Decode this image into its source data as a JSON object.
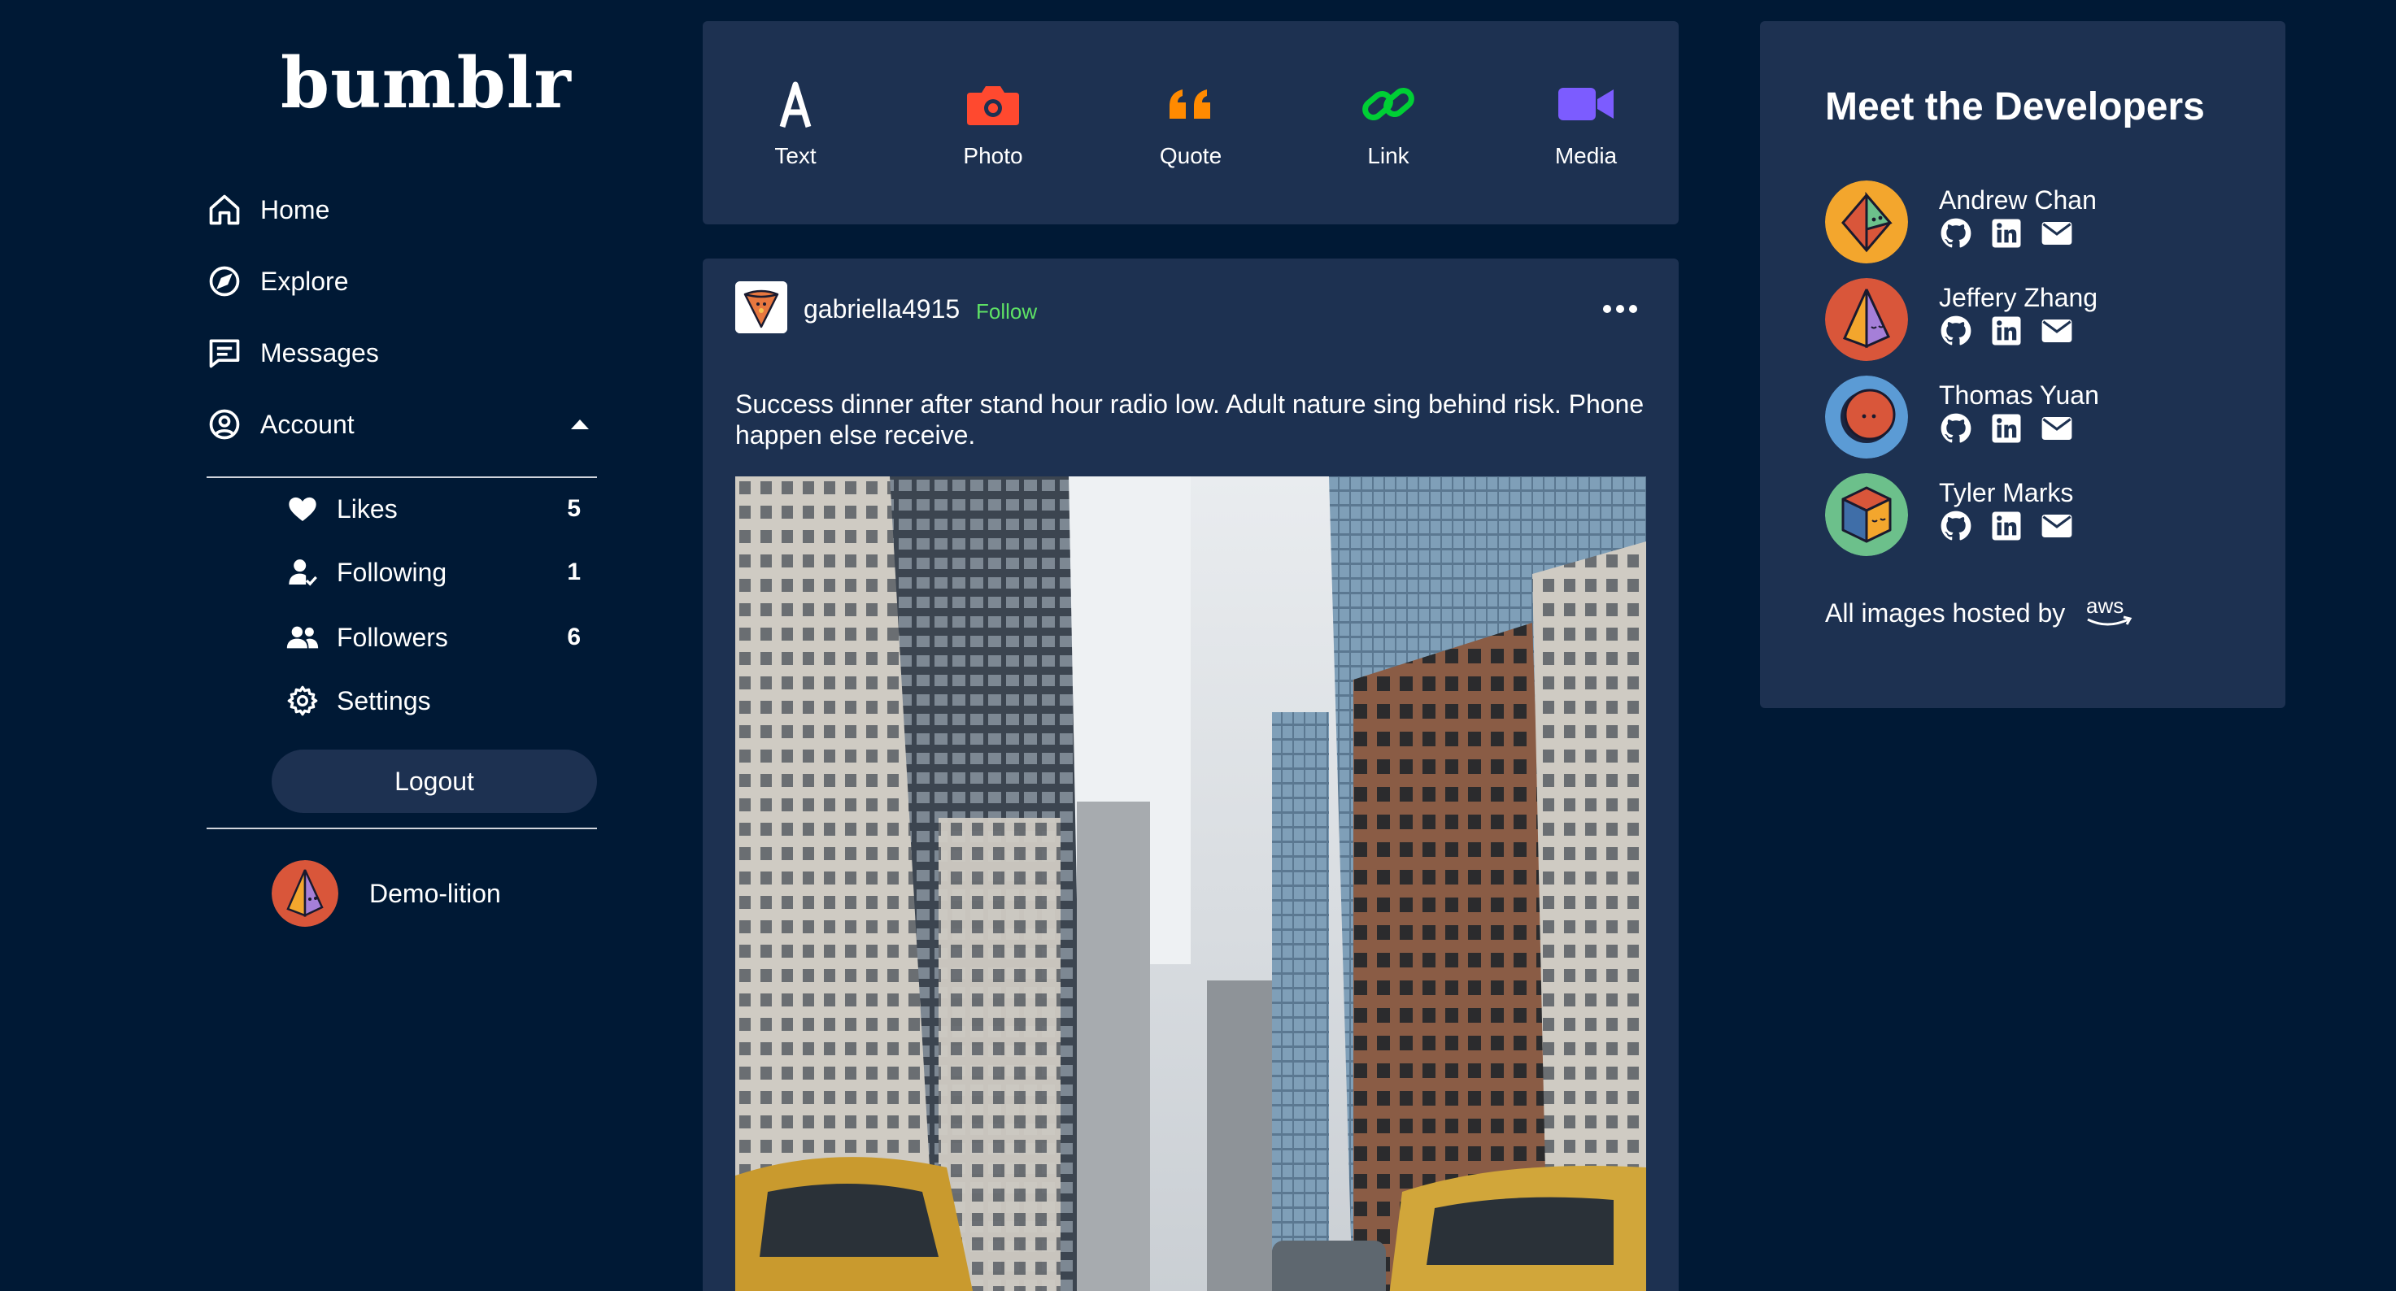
{
  "app": {
    "logo": "bumblr"
  },
  "sidebar": {
    "nav": [
      {
        "label": "Home",
        "icon": "home-icon"
      },
      {
        "label": "Explore",
        "icon": "compass-icon"
      },
      {
        "label": "Messages",
        "icon": "message-icon"
      },
      {
        "label": "Account",
        "icon": "user-circle-icon"
      }
    ],
    "account_menu": [
      {
        "label": "Likes",
        "count": "5",
        "icon": "heart-icon"
      },
      {
        "label": "Following",
        "count": "1",
        "icon": "user-check-icon"
      },
      {
        "label": "Followers",
        "count": "6",
        "icon": "users-icon"
      },
      {
        "label": "Settings",
        "count": "",
        "icon": "gear-icon"
      }
    ],
    "logout_label": "Logout",
    "current_user": {
      "name": "Demo-lition"
    }
  },
  "post_types": [
    {
      "label": "Text",
      "icon": "text-icon",
      "color": "#ffffff"
    },
    {
      "label": "Photo",
      "icon": "camera-icon",
      "color": "#ff492f"
    },
    {
      "label": "Quote",
      "icon": "quote-icon",
      "color": "#ff8a00"
    },
    {
      "label": "Link",
      "icon": "link-icon",
      "color": "#00cf35"
    },
    {
      "label": "Media",
      "icon": "video-icon",
      "color": "#7c5cff"
    }
  ],
  "post": {
    "username": "gabriella4915",
    "follow_label": "Follow",
    "body": "Success dinner after stand hour radio low. Adult nature sing behind risk. Phone happen else receive."
  },
  "developers": {
    "title": "Meet the Developers",
    "people": [
      {
        "name": "Andrew Chan",
        "avatar_bg": "#f3a62d"
      },
      {
        "name": "Jeffery Zhang",
        "avatar_bg": "#d9563a"
      },
      {
        "name": "Thomas Yuan",
        "avatar_bg": "#5b9bd5"
      },
      {
        "name": "Tyler Marks",
        "avatar_bg": "#6cc08b"
      }
    ],
    "hosted_label": "All images hosted by"
  },
  "colors": {
    "background": "#001935",
    "card": "#1d3151",
    "follow": "#5ee265"
  }
}
